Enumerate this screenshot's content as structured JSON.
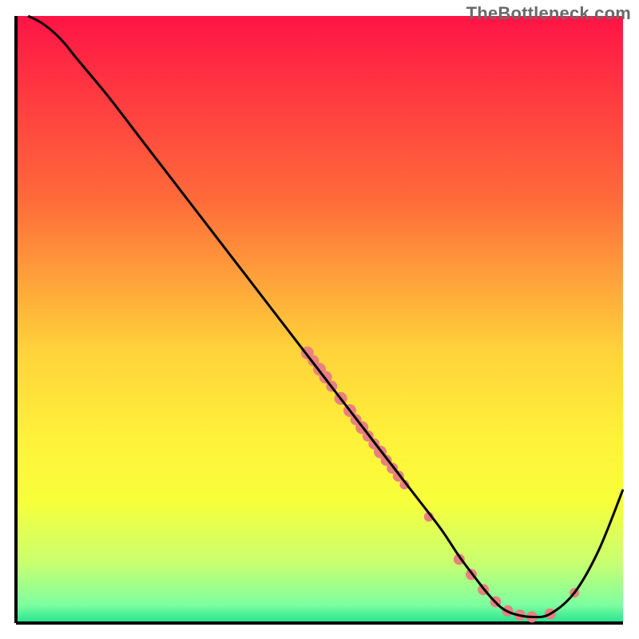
{
  "watermark": "TheBottleneck.com",
  "chart_data": {
    "type": "line",
    "title": "",
    "xlabel": "",
    "ylabel": "",
    "xlim": [
      0,
      100
    ],
    "ylim": [
      0,
      100
    ],
    "grid": false,
    "legend": false,
    "background": {
      "type": "vertical-gradient",
      "stops": [
        {
          "offset": 0,
          "color": "#ff1445"
        },
        {
          "offset": 30,
          "color": "#ff6a3a"
        },
        {
          "offset": 55,
          "color": "#ffd23a"
        },
        {
          "offset": 70,
          "color": "#fff23a"
        },
        {
          "offset": 80,
          "color": "#f7ff3a"
        },
        {
          "offset": 90,
          "color": "#c9ff70"
        },
        {
          "offset": 97,
          "color": "#7effa0"
        },
        {
          "offset": 100,
          "color": "#22e28f"
        }
      ]
    },
    "series": [
      {
        "name": "curve",
        "color": "#000000",
        "x": [
          2,
          4,
          6,
          8,
          10,
          15,
          20,
          25,
          30,
          35,
          40,
          45,
          50,
          55,
          60,
          65,
          70,
          73,
          76,
          78,
          80,
          82,
          85,
          88,
          92,
          96,
          100
        ],
        "y": [
          100,
          99,
          97.5,
          95.5,
          93,
          87,
          80.5,
          74,
          67.5,
          61,
          54.5,
          48,
          41.5,
          35,
          28.5,
          22,
          15.5,
          11,
          7,
          4.5,
          2.5,
          1.5,
          1,
          1.5,
          5,
          12,
          22
        ]
      }
    ],
    "markers": {
      "name": "highlight-dots",
      "color": "#e98080",
      "points": [
        {
          "x": 48,
          "y": 44.5,
          "r": 8
        },
        {
          "x": 49,
          "y": 43.2,
          "r": 7
        },
        {
          "x": 50,
          "y": 41.8,
          "r": 8
        },
        {
          "x": 51,
          "y": 40.5,
          "r": 8
        },
        {
          "x": 52,
          "y": 39.0,
          "r": 7
        },
        {
          "x": 53.5,
          "y": 37.0,
          "r": 8
        },
        {
          "x": 55,
          "y": 35.0,
          "r": 8
        },
        {
          "x": 56,
          "y": 33.5,
          "r": 7
        },
        {
          "x": 57,
          "y": 32.2,
          "r": 8
        },
        {
          "x": 58,
          "y": 30.8,
          "r": 7
        },
        {
          "x": 59,
          "y": 29.5,
          "r": 7
        },
        {
          "x": 60,
          "y": 28.2,
          "r": 8
        },
        {
          "x": 61,
          "y": 26.8,
          "r": 7
        },
        {
          "x": 62,
          "y": 25.5,
          "r": 7
        },
        {
          "x": 63,
          "y": 24.2,
          "r": 7
        },
        {
          "x": 64,
          "y": 22.8,
          "r": 6
        },
        {
          "x": 68,
          "y": 17.5,
          "r": 6
        },
        {
          "x": 73,
          "y": 10.5,
          "r": 7
        },
        {
          "x": 75,
          "y": 8.0,
          "r": 7
        },
        {
          "x": 77,
          "y": 5.5,
          "r": 7
        },
        {
          "x": 79,
          "y": 3.5,
          "r": 7
        },
        {
          "x": 81,
          "y": 2.0,
          "r": 7
        },
        {
          "x": 83,
          "y": 1.3,
          "r": 7
        },
        {
          "x": 85,
          "y": 1.0,
          "r": 7
        },
        {
          "x": 88,
          "y": 1.5,
          "r": 7
        },
        {
          "x": 92,
          "y": 5.0,
          "r": 6
        }
      ]
    }
  }
}
